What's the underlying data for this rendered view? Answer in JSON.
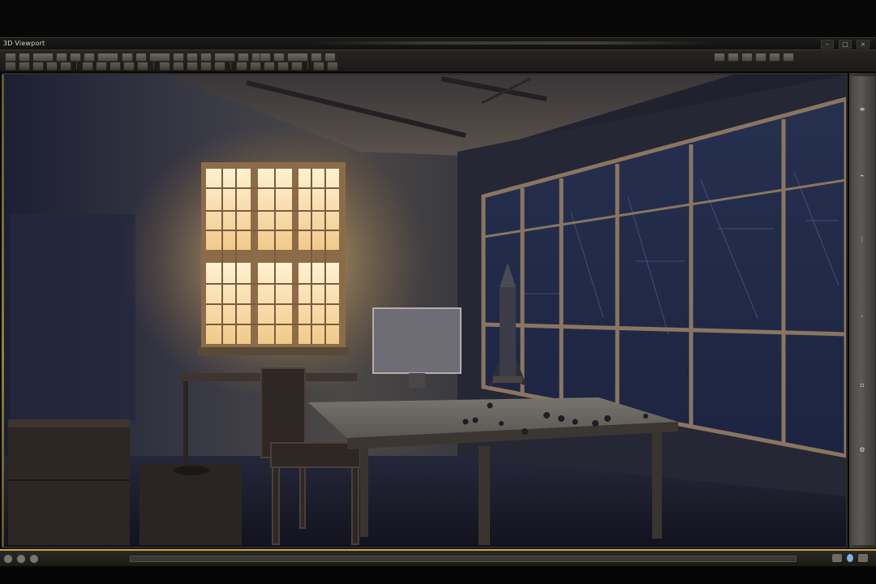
{
  "app": {
    "title": "3D Viewport"
  },
  "window_controls": [
    {
      "name": "minimize-icon",
      "glyph": "–"
    },
    {
      "name": "maximize-icon",
      "glyph": "□"
    },
    {
      "name": "close-icon",
      "glyph": "×"
    }
  ],
  "toolbar": {
    "groups": [
      {
        "name": "file-tools",
        "buttons": [
          "open-icon",
          "save-icon",
          "undo-icon",
          "redo-icon",
          "cut-icon",
          "copy-icon",
          "paste-icon",
          "select-icon"
        ]
      },
      {
        "name": "transform-tools",
        "buttons": [
          "move-icon",
          "rotate-icon",
          "scale-icon",
          "snap-icon",
          "align-icon",
          "mirror-icon",
          "array-icon",
          "link-icon",
          "unlink-icon"
        ]
      },
      {
        "name": "render-tools",
        "buttons": [
          "camera-icon",
          "light-icon",
          "material-icon",
          "render-icon",
          "render-frame-icon"
        ]
      }
    ],
    "right_buttons": [
      "layout-icon",
      "grid-icon",
      "zoom-icon",
      "pan-icon",
      "orbit-icon",
      "maximize-viewport-icon"
    ]
  },
  "right_panel": {
    "icons": [
      {
        "name": "panel-icon-properties",
        "glyph": "≡"
      },
      {
        "name": "panel-icon-modifiers",
        "glyph": "⌁"
      },
      {
        "name": "panel-icon-hierarchy",
        "glyph": "⋮"
      },
      {
        "name": "panel-icon-motion",
        "glyph": "◦"
      },
      {
        "name": "panel-icon-display",
        "glyph": "▫"
      },
      {
        "name": "panel-icon-utilities",
        "glyph": "⚙"
      }
    ]
  },
  "timeline": {
    "playback_buttons": [
      "go-start-icon",
      "play-icon",
      "go-end-icon"
    ],
    "status_icons": [
      "key-mode-icon",
      "autokey-icon",
      "time-config-icon"
    ]
  },
  "colors": {
    "accent": "#c9a93a",
    "chrome": "#1f1e1b",
    "viewport_shadow": "#17192a",
    "window_glow": "#f3d9a7"
  }
}
